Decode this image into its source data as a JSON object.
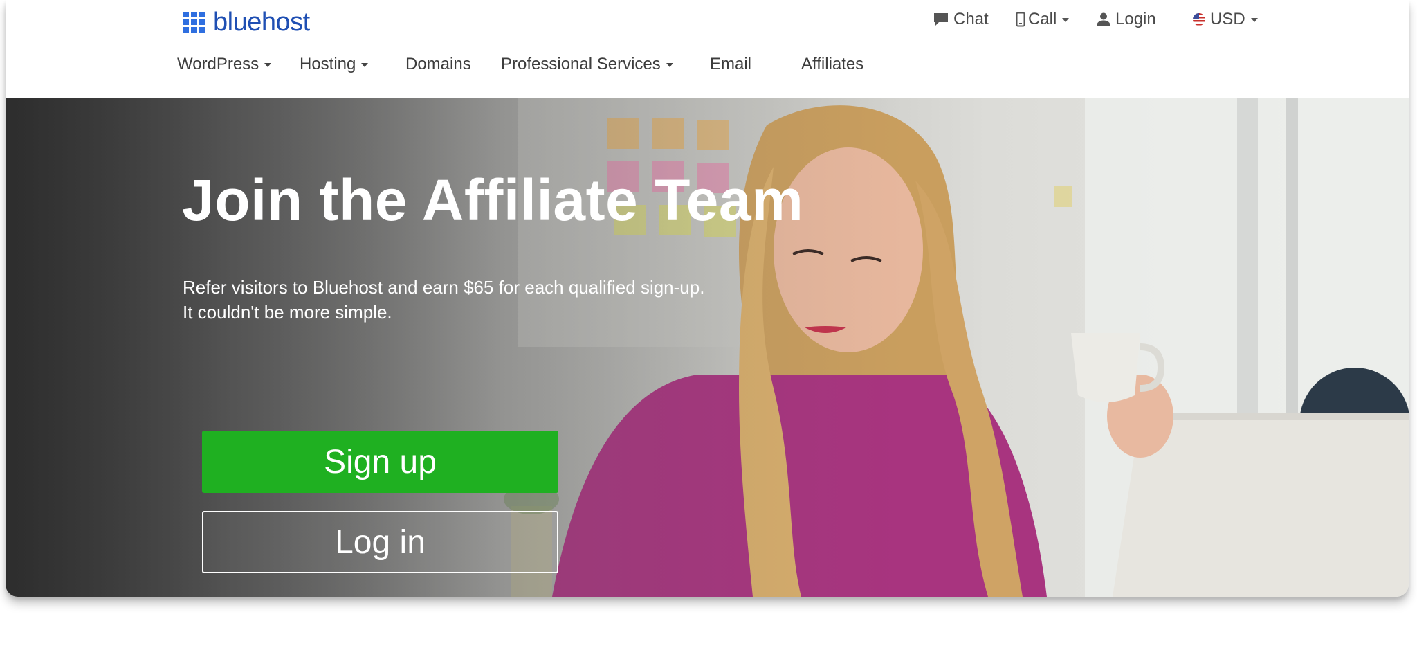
{
  "brand": {
    "name": "bluehost",
    "color": "#2f6fe0"
  },
  "utility_nav": {
    "chat": "Chat",
    "call": "Call",
    "login": "Login",
    "currency": "USD"
  },
  "main_nav": {
    "items": [
      {
        "label": "WordPress",
        "dropdown": true
      },
      {
        "label": "Hosting",
        "dropdown": true
      },
      {
        "label": "Domains",
        "dropdown": false
      },
      {
        "label": "Professional Services",
        "dropdown": true
      },
      {
        "label": "Email",
        "dropdown": false
      },
      {
        "label": "Affiliates",
        "dropdown": false
      }
    ]
  },
  "hero": {
    "title": "Join the Affiliate Team",
    "subtitle_line1": "Refer visitors to Bluehost and earn $65 for each qualified sign-up.",
    "subtitle_line2": "It couldn't be more simple.",
    "signup_label": "Sign up",
    "login_label": "Log in",
    "signup_color": "#1fb021"
  },
  "icons": [
    "logo-grid-icon",
    "chat-bubble-icon",
    "phone-icon",
    "user-icon",
    "us-flag-icon",
    "chevron-down-icon"
  ]
}
